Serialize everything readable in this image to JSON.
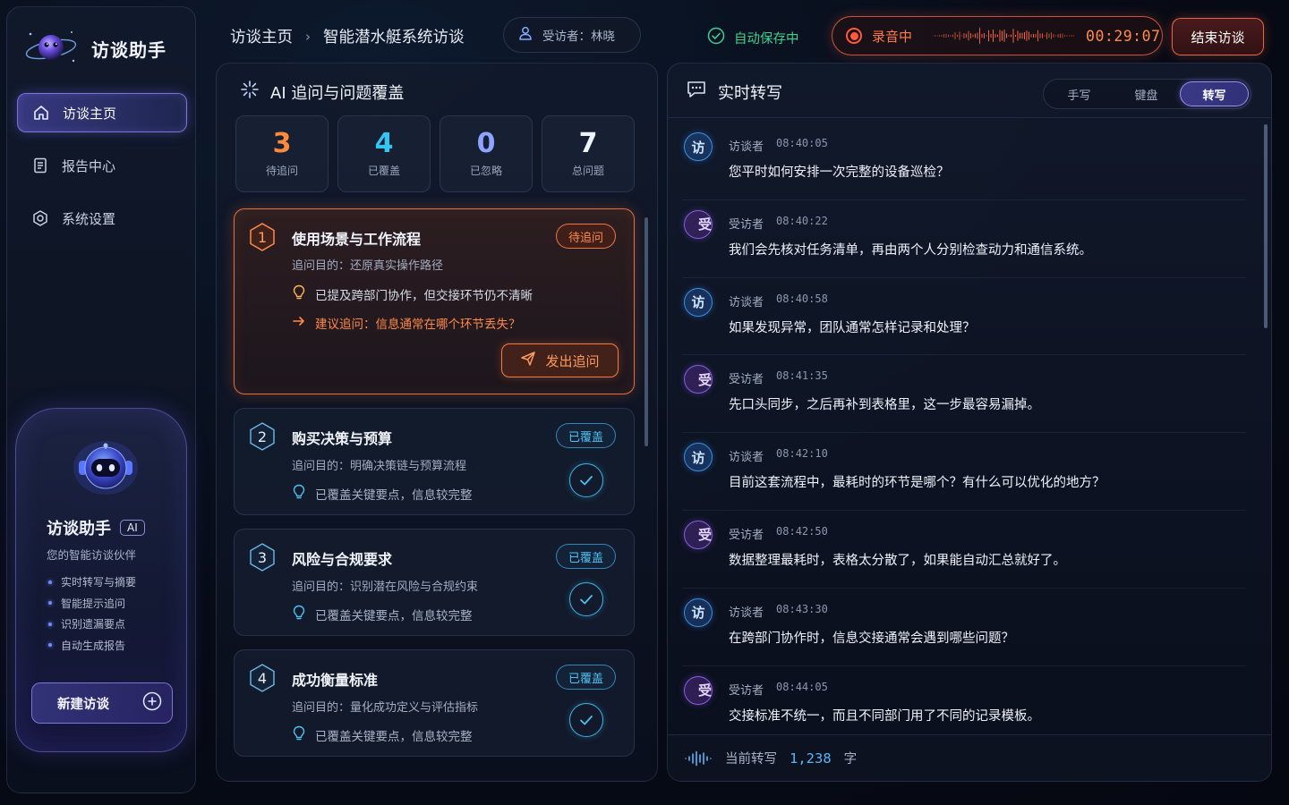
{
  "app": {
    "title": "访谈助手"
  },
  "sidebar": {
    "items": [
      {
        "label": "访谈主页",
        "icon": "home-icon",
        "active": true
      },
      {
        "label": "报告中心",
        "icon": "document-icon",
        "active": false
      },
      {
        "label": "系统设置",
        "icon": "settings-icon",
        "active": false
      }
    ],
    "assistant": {
      "name": "访谈助手",
      "badge": "AI",
      "subtitle": "您的智能访谈伙伴",
      "features": [
        "实时转写与摘要",
        "智能提示追问",
        "识别遗漏要点",
        "自动生成报告"
      ],
      "new_button": "新建访谈"
    }
  },
  "header": {
    "breadcrumb": [
      "访谈主页",
      "智能潜水艇系统访谈"
    ],
    "interviewee": "受访者：林晓",
    "autosave": "自动保存中",
    "recording": {
      "label": "录音中",
      "time": "00:29:07"
    },
    "end_button": "结束访谈"
  },
  "coverage": {
    "title": "AI 追问与问题覆盖",
    "stats": [
      {
        "value": "3",
        "label": "待追问",
        "color": "#ff8a3d"
      },
      {
        "value": "4",
        "label": "已覆盖",
        "color": "#34c5f0"
      },
      {
        "value": "0",
        "label": "已忽略",
        "color": "#8fa4ff"
      },
      {
        "value": "7",
        "label": "总问题",
        "color": "#eef2fb"
      }
    ],
    "topics": [
      {
        "index": "1",
        "title": "使用场景与工作流程",
        "status": "待追问",
        "purpose": "追问目的：还原真实操作路径",
        "insight": "已提及跨部门协作，但交接环节仍不清晰",
        "suggestion": "建议追问：信息通常在哪个环节丢失？",
        "action": "发出追问"
      },
      {
        "index": "2",
        "title": "购买决策与预算",
        "status": "已覆盖",
        "purpose": "追问目的：明确决策链与预算流程",
        "insight": "已覆盖关键要点，信息较完整"
      },
      {
        "index": "3",
        "title": "风险与合规要求",
        "status": "已覆盖",
        "purpose": "追问目的：识别潜在风险与合规约束",
        "insight": "已覆盖关键要点，信息较完整"
      },
      {
        "index": "4",
        "title": "成功衡量标准",
        "status": "已覆盖",
        "purpose": "追问目的：量化成功定义与评估指标",
        "insight": "已覆盖关键要点，信息较完整"
      }
    ]
  },
  "transcript": {
    "title": "实时转写",
    "modes": [
      "手写",
      "键盘",
      "转写"
    ],
    "active_mode": "转写",
    "messages": [
      {
        "avatar": "访",
        "speaker": "访谈者",
        "time": "08:40:05",
        "text": "您平时如何安排一次完整的设备巡检？"
      },
      {
        "avatar": "受",
        "speaker": "受访者",
        "time": "08:40:22",
        "text": "我们会先核对任务清单，再由两个人分别检查动力和通信系统。"
      },
      {
        "avatar": "访",
        "speaker": "访谈者",
        "time": "08:40:58",
        "text": "如果发现异常，团队通常怎样记录和处理？"
      },
      {
        "avatar": "受",
        "speaker": "受访者",
        "time": "08:41:35",
        "text": "先口头同步，之后再补到表格里，这一步最容易漏掉。"
      },
      {
        "avatar": "访",
        "speaker": "访谈者",
        "time": "08:42:10",
        "text": "目前这套流程中，最耗时的环节是哪个？有什么可以优化的地方？"
      },
      {
        "avatar": "受",
        "speaker": "受访者",
        "time": "08:42:50",
        "text": "数据整理最耗时，表格太分散了，如果能自动汇总就好了。"
      },
      {
        "avatar": "访",
        "speaker": "访谈者",
        "time": "08:43:30",
        "text": "在跨部门协作时，信息交接通常会遇到哪些问题？"
      },
      {
        "avatar": "受",
        "speaker": "受访者",
        "time": "08:44:05",
        "text": "交接标准不统一，而且不同部门用了不同的记录模板。"
      }
    ],
    "footer": {
      "label": "当前转写",
      "count": "1,238",
      "unit": "字"
    }
  }
}
